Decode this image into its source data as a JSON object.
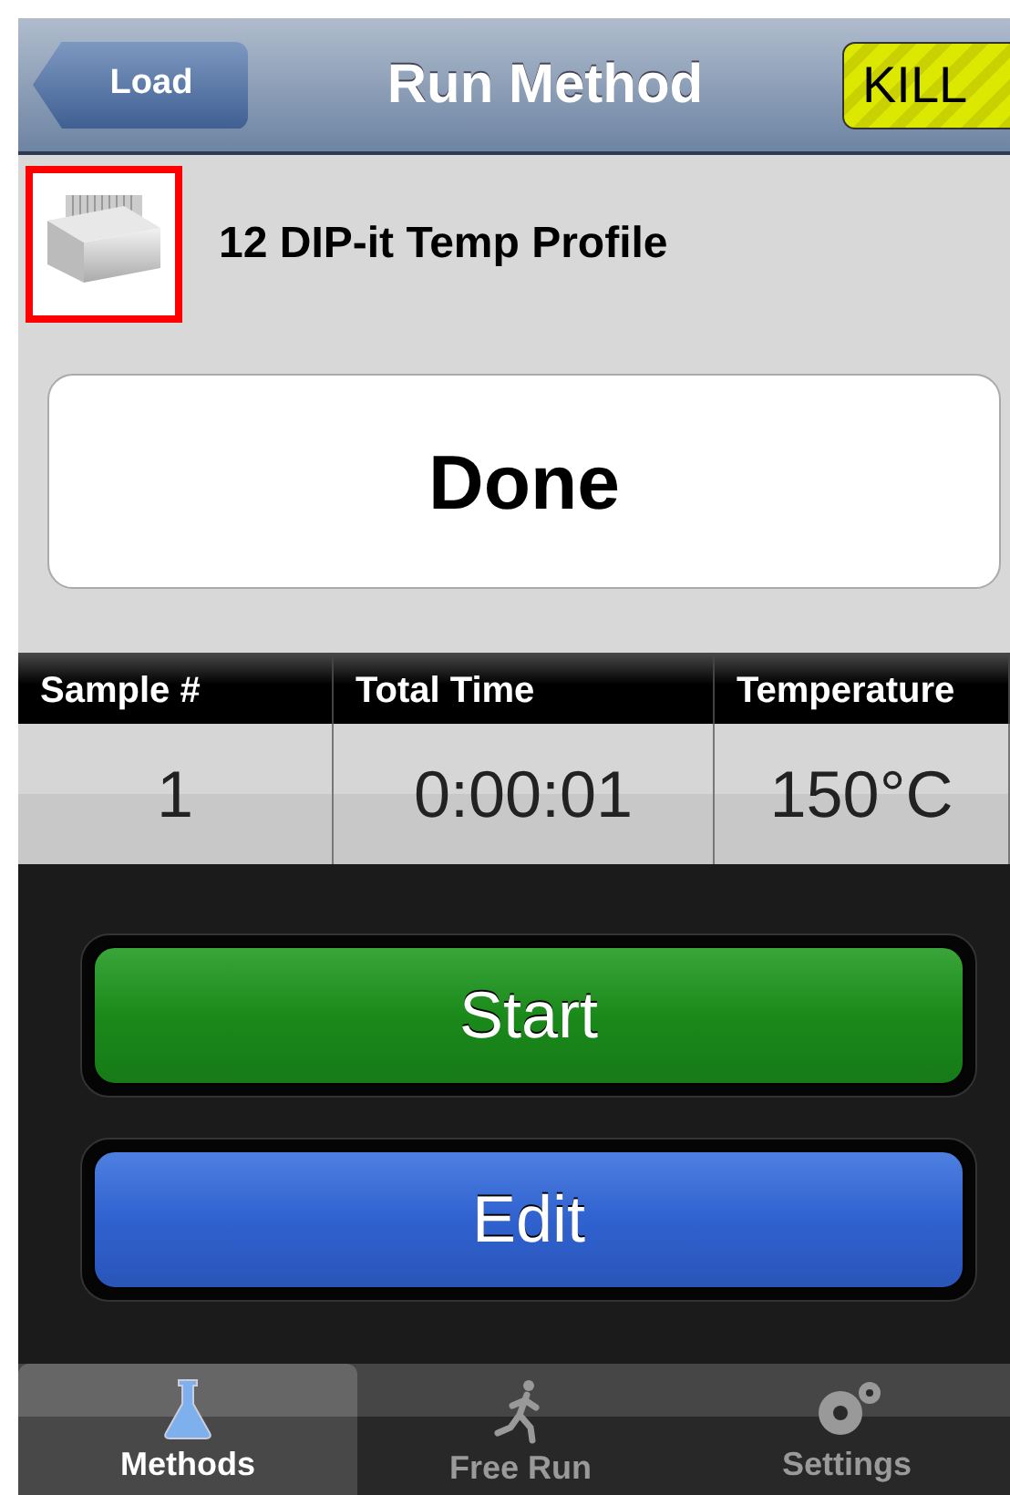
{
  "nav_bar": {
    "back_button": "Load",
    "title": "Run Method",
    "kill_button": "KILL"
  },
  "method": {
    "name": "12 DIP-it Temp Profile",
    "icon_selected": true
  },
  "status": "Done",
  "table": {
    "columns": [
      "Sample #",
      "Total Time",
      "Temperature"
    ],
    "rows": [
      [
        "1",
        "0:00:01",
        "150°C"
      ]
    ]
  },
  "buttons": [
    {
      "label": "Start",
      "kind": "start"
    },
    {
      "label": "Edit",
      "kind": "edit"
    }
  ],
  "tab_bar": [
    {
      "label": "Methods",
      "kind": "flask",
      "selected": true
    },
    {
      "label": "Free Run",
      "kind": "runner",
      "selected": false
    },
    {
      "label": "Settings",
      "kind": "gears",
      "selected": false
    }
  ]
}
